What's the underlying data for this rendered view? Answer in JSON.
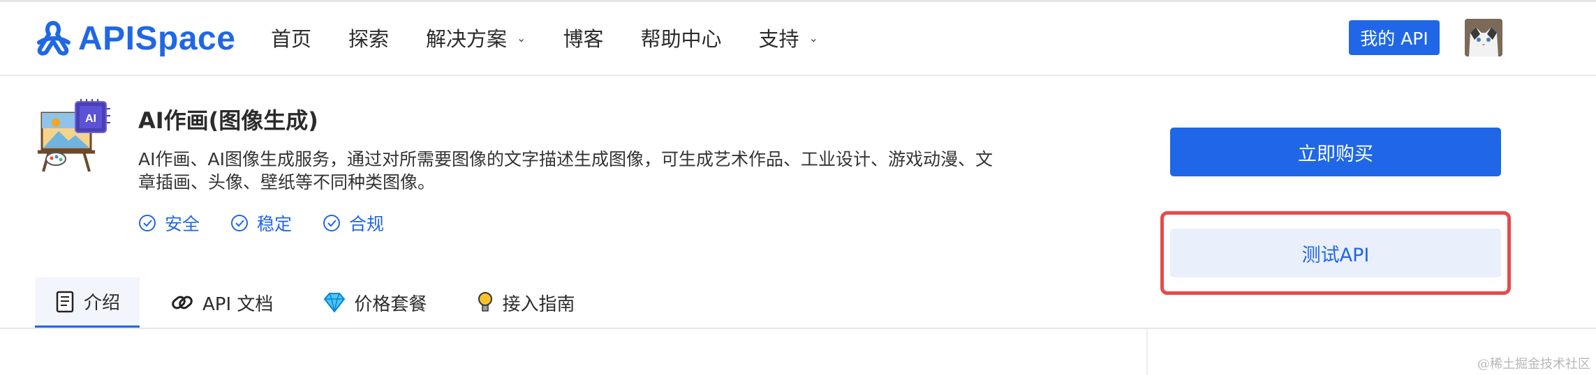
{
  "brand": {
    "name": "APISpace",
    "color": "#1f67e6"
  },
  "nav": {
    "items": [
      {
        "label": "首页",
        "dropdown": false
      },
      {
        "label": "探索",
        "dropdown": false
      },
      {
        "label": "解决方案",
        "dropdown": true
      },
      {
        "label": "博客",
        "dropdown": false
      },
      {
        "label": "帮助中心",
        "dropdown": false
      },
      {
        "label": "支持",
        "dropdown": true
      }
    ],
    "my_api_label": "我的 API",
    "avatar_icon": "user-avatar-cat"
  },
  "product": {
    "icon": "ai-painting-easel-icon",
    "title": "AI作画(图像生成)",
    "description": "AI作画、AI图像生成服务，通过对所需要图像的文字描述生成图像，可生成艺术作品、工业设计、游戏动漫、文章插画、头像、壁纸等不同种类图像。",
    "badges": [
      {
        "label": "安全",
        "icon": "check-circle-icon"
      },
      {
        "label": "稳定",
        "icon": "check-circle-icon"
      },
      {
        "label": "合规",
        "icon": "check-circle-icon"
      }
    ]
  },
  "tabs": [
    {
      "label": "介绍",
      "icon": "document-icon",
      "active": true
    },
    {
      "label": "API 文档",
      "icon": "link-icon",
      "active": false
    },
    {
      "label": "价格套餐",
      "icon": "diamond-icon",
      "active": false
    },
    {
      "label": "接入指南",
      "icon": "lightbulb-icon",
      "active": false
    }
  ],
  "actions": {
    "buy_label": "立即购买",
    "test_label": "测试API",
    "highlight_color": "#e84a4a"
  },
  "watermark": "@稀土掘金技术社区"
}
